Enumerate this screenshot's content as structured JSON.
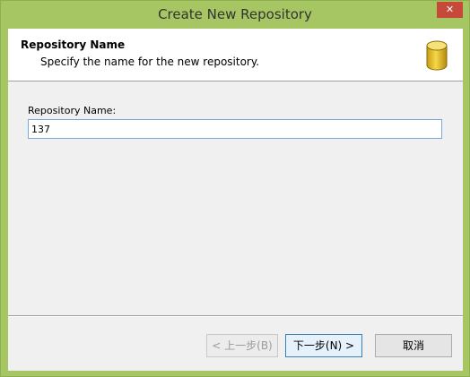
{
  "window": {
    "title": "Create New Repository",
    "close_glyph": "✕"
  },
  "header": {
    "title": "Repository Name",
    "subtitle": "Specify the name for the new repository.",
    "icon": "database-icon"
  },
  "form": {
    "label": "Repository Name:",
    "value": "137"
  },
  "buttons": {
    "back": "< 上一步(B)",
    "next": "下一步(N) >",
    "cancel": "取消"
  },
  "colors": {
    "frame": "#a6c663",
    "close": "#c7493a",
    "icon_gold": "#e8c22c"
  }
}
